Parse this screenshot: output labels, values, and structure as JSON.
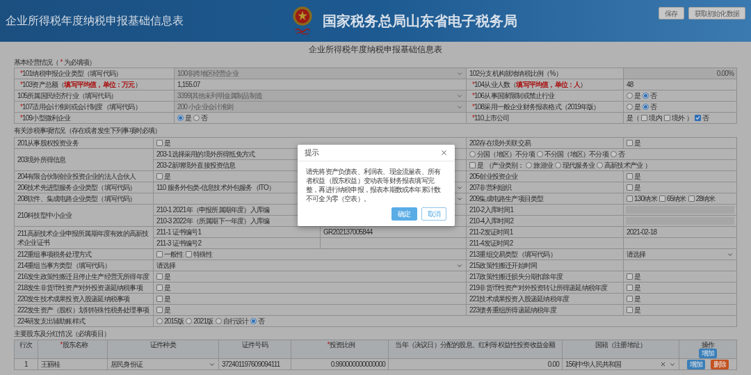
{
  "header": {
    "title": "企业所得税年度纳税申报基础信息表",
    "site_name": "国家税务总局山东省电子税务局",
    "buttons": [
      "保存",
      "获取初始化数据"
    ]
  },
  "form_title": "企业所得税年度纳税申报基础信息表",
  "basic": {
    "heading": {
      "before": "基本经营情况（",
      "mark": "*",
      "after": "为必填项）"
    },
    "rows": [
      {
        "label": "101纳税申报企业类型（填写代码）",
        "required": true,
        "value": {
          "kind": "select",
          "value": "100非跨地区经营企业",
          "disabled": true
        },
        "right_label": "102分支机构就地纳税比例（%）",
        "right_required": false,
        "right_value": {
          "kind": "number",
          "value": "0.00%",
          "disabled": true
        }
      },
      {
        "label": "103资产总额（**填写平均值，单位：万元**）",
        "required": true,
        "value": {
          "kind": "text",
          "value": "1,155.07"
        },
        "right_label": "104从业人数（**填写平均值，单位：人**）",
        "right_required": true,
        "right_value": {
          "kind": "text",
          "value": "48"
        }
      },
      {
        "label": "105所属国民经济行业（填写代码）",
        "required": false,
        "value": {
          "kind": "select",
          "value": "3399|其他未列明金属制品制造",
          "disabled": true
        },
        "right_label": "106从事国家限制或禁止行业",
        "right_required": true,
        "right_value": {
          "kind": "choices",
          "items": [
            {
              "kind": "radio",
              "label": "是",
              "selected": false
            },
            {
              "kind": "radio",
              "label": "否",
              "selected": true
            }
          ]
        }
      },
      {
        "label": "107适用会计准则或会计制度（填写代码）",
        "required": true,
        "value": {
          "kind": "select",
          "value": "200 小企业会计准则",
          "disabled": true
        },
        "right_label": "108采用一般企业财务报表格式（2019年版）",
        "right_required": true,
        "right_value": {
          "kind": "choices",
          "items": [
            {
              "kind": "radio",
              "label": "是",
              "selected": false
            },
            {
              "kind": "radio",
              "label": "否",
              "selected": true
            }
          ]
        }
      },
      {
        "label": "109小型微利企业",
        "required": true,
        "value": {
          "kind": "choices",
          "items": [
            {
              "kind": "radio",
              "label": "是",
              "selected": true
            },
            {
              "kind": "radio",
              "label": "否",
              "selected": false
            }
          ]
        },
        "right_label": "110上市公司",
        "right_required": true,
        "right_value": {
          "kind": "choices",
          "items": [
            {
              "kind": "text",
              "label": "是（"
            },
            {
              "kind": "checkbox",
              "label": "境内",
              "checked": false
            },
            {
              "kind": "checkbox",
              "label": "境外",
              "checked": false
            },
            {
              "kind": "text",
              "label": "）"
            },
            {
              "kind": "checkbox",
              "label": "否",
              "checked": true
            }
          ]
        }
      }
    ]
  },
  "tax": {
    "heading": "有关涉税事项情况（存在或者发生下列事项时必填）",
    "rows": [
      {
        "label": "201从事股权投资业务",
        "value": {
          "kind": "choices",
          "items": [
            {
              "kind": "checkbox",
              "label": "是",
              "checked": false
            }
          ]
        },
        "right_label": "202存在境外关联交易",
        "right_value": {
          "kind": "choices",
          "items": [
            {
              "kind": "checkbox",
              "label": "是",
              "checked": false
            }
          ]
        }
      },
      {
        "label": "203境外所得信息",
        "children": [
          {
            "label": "203-1选择采用的境外所得抵免方式",
            "span_value": {
              "kind": "choices",
              "items": [
                {
                  "kind": "radio",
                  "label": "分国（地区）不分项",
                  "selected": false
                },
                {
                  "kind": "radio",
                  "label": "不分国（地区）不分项",
                  "selected": false
                },
                {
                  "kind": "radio",
                  "label": "否",
                  "selected": false
                }
              ]
            }
          },
          {
            "label": "203-2新增境外直接投资信息",
            "span_value": {
              "kind": "choices",
              "items": [
                {
                  "kind": "checkbox",
                  "label": "是",
                  "checked": false
                },
                {
                  "kind": "text",
                  "label": "（产业类别："
                },
                {
                  "kind": "radio",
                  "label": "旅游业",
                  "selected": false
                },
                {
                  "kind": "radio",
                  "label": "现代服务业",
                  "selected": false
                },
                {
                  "kind": "radio",
                  "label": "高新技术产业",
                  "selected": false
                },
                {
                  "kind": "text",
                  "label": "）"
                }
              ]
            }
          }
        ]
      },
      {
        "label": "204有限合伙制创业投资企业的法人合伙人",
        "value": {
          "kind": "choices",
          "items": [
            {
              "kind": "checkbox",
              "label": "是",
              "checked": false
            }
          ]
        },
        "right_label": "205创业投资企业",
        "right_value": {
          "kind": "choices",
          "items": [
            {
              "kind": "checkbox",
              "label": "是",
              "checked": false
            }
          ]
        }
      },
      {
        "label": "206技术先进型服务企业类型（填写代码）",
        "value": {
          "kind": "select",
          "value": "110 服务外包类-信息技术外包服务（ITO）"
        },
        "right_label": "207非营利组织",
        "right_value": {
          "kind": "choices",
          "items": [
            {
              "kind": "checkbox",
              "label": "是",
              "checked": false
            }
          ]
        }
      },
      {
        "label": "208软件、集成电路企业类型（填写代码）",
        "value": {
          "kind": "select"
        },
        "right_label": "209集成电路生产项目类型",
        "right_value": {
          "kind": "choices",
          "items": [
            {
              "kind": "checkbox",
              "label": "130纳米",
              "checked": false
            },
            {
              "kind": "checkbox",
              "label": "65纳米",
              "checked": false
            },
            {
              "kind": "checkbox",
              "label": "28纳米",
              "checked": false
            }
          ]
        }
      },
      {
        "label": "210科技型中小企业",
        "children": [
          {
            "label": "210-1 2021年（申报所属期年度）入库编",
            "right_label": "210-2入库时间1",
            "right_value": {
              "kind": "input",
              "disabled": true
            }
          },
          {
            "label": "210-3 2022年（所属期下一年度）入库编",
            "right_label": "210-4入库时间2",
            "right_value": {
              "kind": "input",
              "disabled": true
            }
          }
        ]
      },
      {
        "label": "211高新技术企业申报所属期年度有效的高新技术企业证书",
        "children": [
          {
            "label": "211-1 证书编号1",
            "value": {
              "kind": "text",
              "value": "GR202137005844"
            },
            "right_label": "211-2发证时间1",
            "right_value": {
              "kind": "text",
              "value": "2021-02-18"
            }
          },
          {
            "label": "211-3 证书编号2",
            "right_label": "211-4发证时间2"
          }
        ]
      },
      {
        "label": "212重组事项税务处理方式",
        "value": {
          "kind": "choices",
          "items": [
            {
              "kind": "checkbox",
              "label": "一般性",
              "checked": false
            },
            {
              "kind": "checkbox",
              "label": "特殊性",
              "checked": false
            }
          ]
        },
        "right_label": "213重组交易类型（填写代码）",
        "right_value": {
          "kind": "select",
          "value": "请选择"
        }
      },
      {
        "label": "214重组当事方类型（填写代码）",
        "value": {
          "kind": "select",
          "value": "请选择"
        },
        "right_label": "215政策性搬迁开始时间"
      },
      {
        "label": "216发生政策性搬迁且停止生产经营无所得年度",
        "value": {
          "kind": "choices",
          "items": [
            {
              "kind": "checkbox",
              "label": "是",
              "checked": false
            }
          ]
        },
        "right_label": "217政策性搬迁损失分期扣除年度",
        "right_value": {
          "kind": "choices",
          "items": [
            {
              "kind": "checkbox",
              "label": "是",
              "checked": false
            }
          ]
        }
      },
      {
        "label": "218发生非货币性资产对外投资递延纳税事项",
        "value": {
          "kind": "choices",
          "items": [
            {
              "kind": "checkbox",
              "label": "是",
              "checked": false
            }
          ]
        },
        "right_label": "219非货币性资产对外投资转让所得递延纳税年度",
        "right_value": {
          "kind": "choices",
          "items": [
            {
              "kind": "checkbox",
              "label": "是",
              "checked": false
            }
          ]
        }
      },
      {
        "label": "220发生技术成果投资入股递延纳税事项",
        "value": {
          "kind": "choices",
          "items": [
            {
              "kind": "checkbox",
              "label": "是",
              "checked": false
            }
          ]
        },
        "right_label": "221技术成果投资入股递延纳税年度",
        "right_value": {
          "kind": "choices",
          "items": [
            {
              "kind": "checkbox",
              "label": "是",
              "checked": false
            }
          ]
        }
      },
      {
        "label": "222发生资产（股权）划转特殊性税务处理事项",
        "value": {
          "kind": "choices",
          "items": [
            {
              "kind": "checkbox",
              "label": "是",
              "checked": false
            }
          ]
        },
        "right_label": "223债务重组所得递延纳税年度",
        "right_value": {
          "kind": "choices",
          "items": [
            {
              "kind": "checkbox",
              "label": "是",
              "checked": false
            }
          ]
        }
      },
      {
        "label": "224研发支出辅助账样式",
        "span_value": {
          "kind": "choices",
          "items": [
            {
              "kind": "radio",
              "label": "2015版",
              "selected": false
            },
            {
              "kind": "radio",
              "label": "2021版",
              "selected": false
            },
            {
              "kind": "radio",
              "label": "自行设计",
              "selected": false
            },
            {
              "kind": "radio",
              "label": "否",
              "selected": true
            }
          ]
        }
      }
    ]
  },
  "shareholders": {
    "heading": "主要股东及分红情况（必填项目）",
    "columns": [
      {
        "label": "行次",
        "required": false
      },
      {
        "label": "股东名称",
        "required": true
      },
      {
        "label": "证件种类",
        "required": false
      },
      {
        "label": "证件号码",
        "required": false
      },
      {
        "label": "投资比例",
        "required": true
      },
      {
        "label": "当年（决议日）分配的股息、红利等权益性投资收益金额",
        "required": false
      },
      {
        "label": "国籍（注册地址）",
        "required": false
      },
      {
        "label": "操作",
        "required": false
      }
    ],
    "header_button": "增加",
    "rows": [
      {
        "index": "1",
        "name": "王丽桂",
        "id_type": "居民身份证",
        "id_number": "372401197609094111",
        "ratio": "0.990000000000000",
        "amount": "0.00",
        "nationality": "156|中华人民共和国",
        "actions": [
          {
            "label": "增加",
            "kind": "add"
          },
          {
            "label": "删除",
            "kind": "delete"
          }
        ]
      }
    ]
  },
  "dialog": {
    "title": "提示",
    "message": "请先将资产负债表、利润表、现金流量表、所有者权益（股东权益）变动表等财务报表填写完整，再进行纳税申报，报表本期数或本年累计数不可全为零（空表）。",
    "buttons": [
      {
        "label": "确定",
        "kind": "primary"
      },
      {
        "label": "取消",
        "kind": "secondary"
      }
    ]
  }
}
